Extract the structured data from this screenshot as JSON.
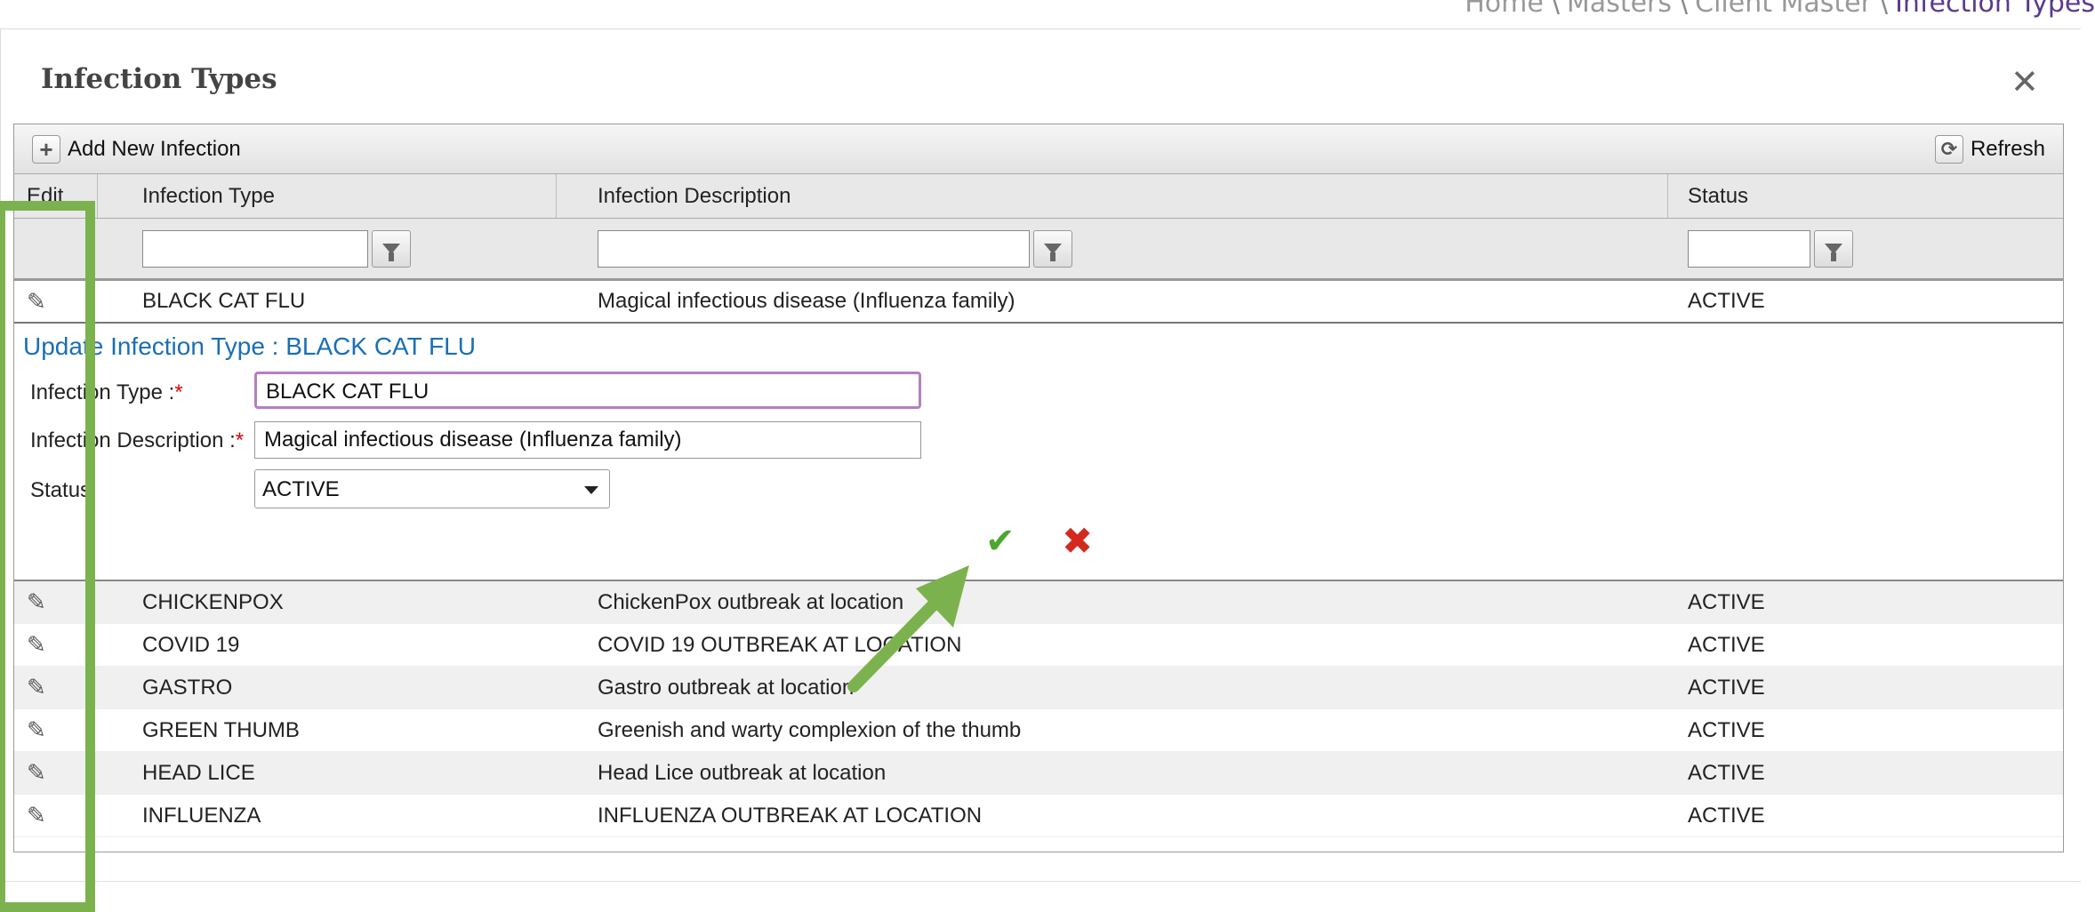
{
  "breadcrumb": {
    "items": [
      "Home",
      "Masters",
      "Client Master",
      "Infection Types"
    ],
    "separator": "\\"
  },
  "panel": {
    "title": "Infection Types",
    "close_icon": "close-icon"
  },
  "toolbar": {
    "add_label": "Add New Infection",
    "add_icon": "plus-icon",
    "refresh_label": "Refresh",
    "refresh_icon": "refresh-icon"
  },
  "columns": {
    "edit": "Edit",
    "type": "Infection Type",
    "description": "Infection Description",
    "status": "Status"
  },
  "selected_row": {
    "type": "BLACK CAT FLU",
    "description": "Magical infectious disease (Influenza family)",
    "status": "ACTIVE"
  },
  "edit_form": {
    "title": "Update Infection Type : BLACK CAT FLU",
    "type_label": "Infection Type :",
    "description_label": "Infection Description :",
    "status_label": "Status",
    "required_mark": "*",
    "type_value": "BLACK CAT FLU",
    "description_value": "Magical infectious disease (Influenza family)",
    "status_value": "ACTIVE",
    "save_icon": "checkmark-icon",
    "cancel_icon": "red-x-icon"
  },
  "rows": [
    {
      "type": "CHICKENPOX",
      "description": "ChickenPox outbreak at location",
      "status": "ACTIVE"
    },
    {
      "type": "COVID 19",
      "description": "COVID 19 OUTBREAK AT LOCATION",
      "status": "ACTIVE"
    },
    {
      "type": "GASTRO",
      "description": "Gastro outbreak at location",
      "status": "ACTIVE"
    },
    {
      "type": "GREEN THUMB",
      "description": "Greenish and warty complexion of the thumb",
      "status": "ACTIVE"
    },
    {
      "type": "HEAD LICE",
      "description": "Head Lice outbreak at location",
      "status": "ACTIVE"
    },
    {
      "type": "INFLUENZA",
      "description": "INFLUENZA OUTBREAK AT LOCATION",
      "status": "ACTIVE"
    }
  ],
  "colors": {
    "annotation_green": "#7cb24e",
    "title_blue": "#1a6fb4",
    "focus_purple": "#b57fbf",
    "save_green": "#4aa82e",
    "cancel_red": "#d42a1e"
  }
}
